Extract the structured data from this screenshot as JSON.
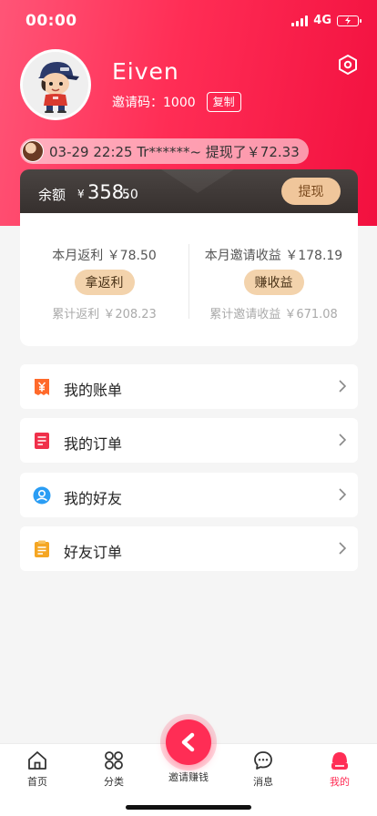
{
  "status_bar": {
    "time": "00:00",
    "network": "4G",
    "icons": [
      "signal-icon",
      "battery-charging-icon"
    ]
  },
  "profile": {
    "username": "Eiven",
    "invite_code_label": "邀请码：",
    "invite_code": "1000",
    "copy_label": "复制",
    "settings_icon": "settings-hexagon-icon"
  },
  "ticker": {
    "text": "03-29 22:25   Tr******~ 提现了￥72.33"
  },
  "balance": {
    "label": "余额",
    "currency": "¥",
    "integer": "358.",
    "decimal": "50",
    "withdraw_label": "提现"
  },
  "earnings": {
    "left": {
      "title": "本月返利 ￥78.50",
      "button": "拿返利",
      "total": "累计返利 ￥208.23"
    },
    "right": {
      "title": "本月邀请收益 ￥178.19",
      "button": "赚收益",
      "total": "累计邀请收益 ￥671.08"
    }
  },
  "menu": [
    {
      "label": "我的账单",
      "icon": "bill-yen-icon",
      "color": "#ff6a2b"
    },
    {
      "label": "我的订单",
      "icon": "order-list-icon",
      "color": "#f0304a"
    },
    {
      "label": "我的好友",
      "icon": "friend-user-icon",
      "color": "#2a9df4"
    },
    {
      "label": "好友订单",
      "icon": "clipboard-icon",
      "color": "#f5a623"
    }
  ],
  "tabbar": {
    "items": [
      {
        "label": "首页",
        "icon": "home-icon"
      },
      {
        "label": "分类",
        "icon": "category-icon"
      },
      {
        "label": "邀请赚钱",
        "icon": "invite-logo-icon"
      },
      {
        "label": "消息",
        "icon": "message-icon"
      },
      {
        "label": "我的",
        "icon": "profile-icon"
      }
    ],
    "active_index": 4
  },
  "colors": {
    "brand": "#ff2d55",
    "gold_button": "#f0c69b",
    "dark_card": "#3c3634"
  }
}
